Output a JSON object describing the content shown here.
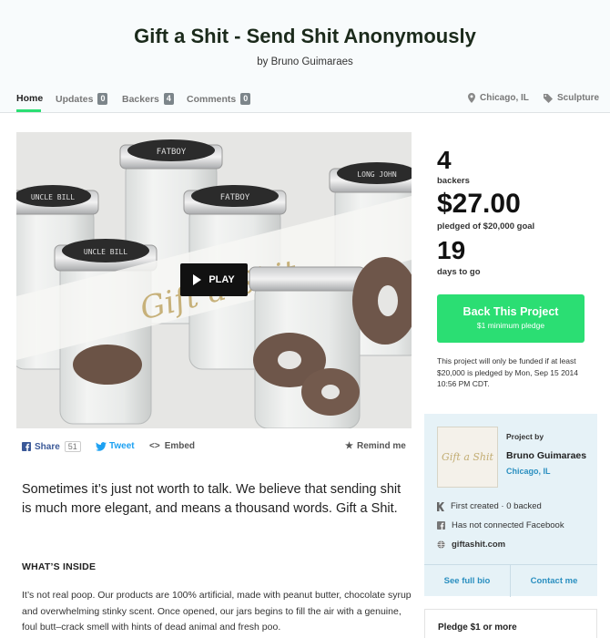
{
  "project": {
    "title": "Gift a Shit - Send Shit Anonymously",
    "byline": "by Bruno Guimaraes"
  },
  "nav": {
    "home": "Home",
    "updates": {
      "label": "Updates",
      "count": "0"
    },
    "backers": {
      "label": "Backers",
      "count": "4"
    },
    "comments": {
      "label": "Comments",
      "count": "0"
    },
    "location": "Chicago, IL",
    "category": "Sculpture"
  },
  "video": {
    "play_label": "PLAY",
    "jar_labels": [
      "FATBOY",
      "UNCLE BILL",
      "FATBOY",
      "LONG JOHN",
      "UNCLE BILL"
    ],
    "logo_text": "Gift a Shit"
  },
  "share": {
    "facebook": "Share",
    "facebook_count": "51",
    "tweet": "Tweet",
    "embed": "Embed",
    "remind": "Remind me"
  },
  "description": {
    "blurb": "Sometimes it’s just not worth to talk. We believe that sending shit is much more elegant, and means a thousand words. Gift a Shit.",
    "section_heading": "WHAT’S INSIDE",
    "body": "It’s not real poop. Our products are 100% artificial, made with peanut butter, chocolate syrup and overwhelming stinky scent. Once opened, our jars begins to fill the air with a genuine, foul butt–crack smell with hints of dead animal and fresh poo."
  },
  "stats": {
    "backers": {
      "value": "4",
      "label": "backers"
    },
    "pledged": {
      "value": "$27.00",
      "label": "pledged of $20,000 goal"
    },
    "days": {
      "value": "19",
      "label": "days to go"
    }
  },
  "back_button": {
    "label": "Back This Project",
    "sub": "$1 minimum pledge"
  },
  "funding_note": "This project will only be funded if at least $20,000 is pledged by Mon, Sep 15 2014 10:56 PM CDT.",
  "creator": {
    "heading": "Project by",
    "name": "Bruno Guimaraes",
    "location": "Chicago, IL",
    "logo_text": "Gift a Shit",
    "created": "First created · 0 backed",
    "facebook": "Has not connected Facebook",
    "website": "giftashit.com",
    "bio_button": "See full bio",
    "contact_button": "Contact me"
  },
  "pledge": {
    "heading": "Pledge $1 or more"
  },
  "colors": {
    "accent": "#2bde73",
    "link": "#2a8fc0",
    "facebook": "#3b5998",
    "twitter": "#1da1f2"
  },
  "icons": [
    "location-pin-icon",
    "tag-icon",
    "facebook-icon",
    "twitter-icon",
    "embed-icon",
    "star-icon",
    "kickstarter-icon",
    "globe-icon",
    "play-icon"
  ]
}
